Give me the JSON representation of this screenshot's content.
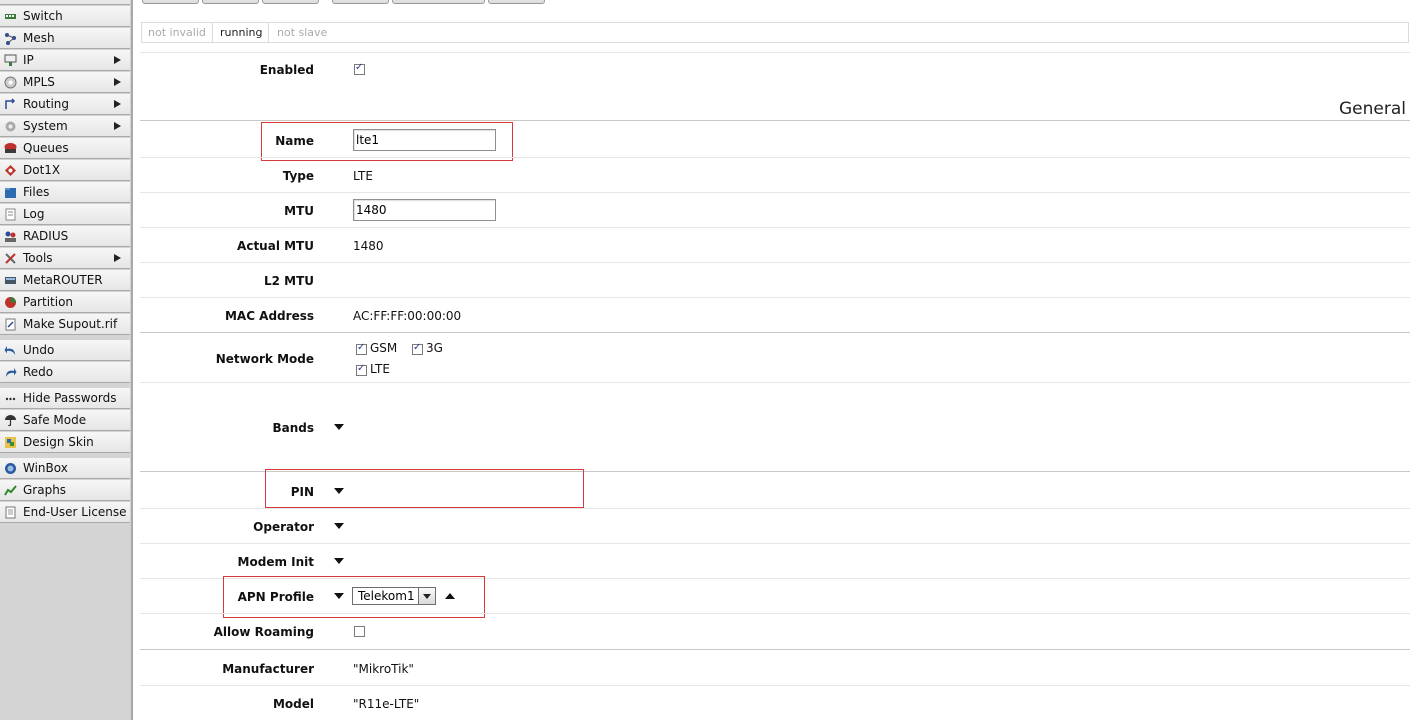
{
  "sidebar": {
    "items": [
      {
        "label": "Switch",
        "icon": "switch-icon",
        "submenu": false
      },
      {
        "label": "Mesh",
        "icon": "mesh-icon",
        "submenu": false
      },
      {
        "label": "IP",
        "icon": "ip-icon",
        "submenu": true
      },
      {
        "label": "MPLS",
        "icon": "mpls-icon",
        "submenu": true
      },
      {
        "label": "Routing",
        "icon": "routing-icon",
        "submenu": true
      },
      {
        "label": "System",
        "icon": "gear-icon",
        "submenu": true
      },
      {
        "label": "Queues",
        "icon": "queues-icon",
        "submenu": false
      },
      {
        "label": "Dot1X",
        "icon": "dot1x-icon",
        "submenu": false
      },
      {
        "label": "Files",
        "icon": "folder-icon",
        "submenu": false
      },
      {
        "label": "Log",
        "icon": "log-icon",
        "submenu": false
      },
      {
        "label": "RADIUS",
        "icon": "radius-icon",
        "submenu": false
      },
      {
        "label": "Tools",
        "icon": "tools-icon",
        "submenu": true
      },
      {
        "label": "MetaROUTER",
        "icon": "metarouter-icon",
        "submenu": false
      },
      {
        "label": "Partition",
        "icon": "partition-icon",
        "submenu": false
      },
      {
        "label": "Make Supout.rif",
        "icon": "supout-icon",
        "submenu": false
      },
      {
        "label": "Undo",
        "icon": "undo-icon",
        "submenu": false
      },
      {
        "label": "Redo",
        "icon": "redo-icon",
        "submenu": false
      },
      {
        "label": "Hide Passwords",
        "icon": "password-icon",
        "submenu": false
      },
      {
        "label": "Safe Mode",
        "icon": "umbrella-icon",
        "submenu": false
      },
      {
        "label": "Design Skin",
        "icon": "skin-icon",
        "submenu": false
      },
      {
        "label": "WinBox",
        "icon": "winbox-icon",
        "submenu": false
      },
      {
        "label": "Graphs",
        "icon": "graphs-icon",
        "submenu": false
      },
      {
        "label": "End-User License",
        "icon": "license-icon",
        "submenu": false
      }
    ]
  },
  "status": {
    "not_invalid": "not invalid",
    "running": "running",
    "not_slave": "not slave"
  },
  "form": {
    "enabled_label": "Enabled",
    "enabled": true,
    "section_title": "General",
    "name_label": "Name",
    "name_value": "lte1",
    "type_label": "Type",
    "type_value": "LTE",
    "mtu_label": "MTU",
    "mtu_value": "1480",
    "actual_mtu_label": "Actual MTU",
    "actual_mtu_value": "1480",
    "l2mtu_label": "L2 MTU",
    "mac_label": "MAC Address",
    "mac_value": "AC:FF:FF:00:00:00",
    "network_mode_label": "Network Mode",
    "network_modes": [
      {
        "label": "GSM",
        "checked": true
      },
      {
        "label": "3G",
        "checked": true
      },
      {
        "label": "LTE",
        "checked": true
      }
    ],
    "bands_label": "Bands",
    "pin_label": "PIN",
    "operator_label": "Operator",
    "modem_init_label": "Modem Init",
    "apn_label": "APN Profile",
    "apn_value": "Telekom1",
    "allow_roaming_label": "Allow Roaming",
    "allow_roaming": false,
    "manufacturer_label": "Manufacturer",
    "manufacturer_value": "\"MikroTik\"",
    "model_label": "Model",
    "model_value": "\"R11e-LTE\""
  },
  "colors": {
    "highlight": "#d63b3b",
    "sidebar_bg": "#d4d4d4"
  }
}
